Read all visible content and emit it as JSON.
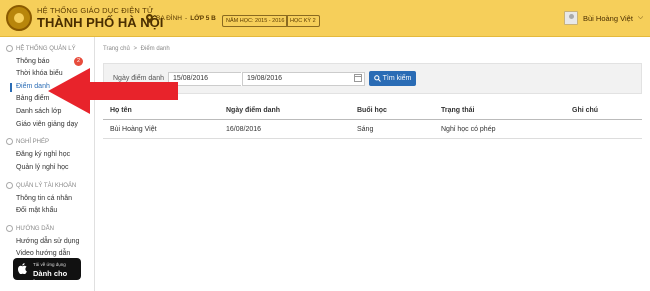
{
  "header": {
    "brand_top": "HỆ THỐNG GIÁO DỤC ĐIỆN TỬ",
    "brand_bottom": "THÀNH PHỐ HÀ NỘI",
    "location_area": "BA ĐÌNH",
    "location_sep": " - ",
    "location_class": "LỚP 5 B",
    "school_year": "NĂM HỌC: 2015 - 2016",
    "semester": "HỌC KỲ 2",
    "user_name": "Bùi Hoàng Việt"
  },
  "sidebar": {
    "sections": [
      {
        "title": "HỆ THỐNG QUẢN LÝ",
        "items": [
          "Thông báo",
          "Thời khóa biểu",
          "Điểm danh",
          "Bảng điểm",
          "Danh sách lớp",
          "Giáo viên giảng dạy"
        ]
      },
      {
        "title": "NGHỈ PHÉP",
        "items": [
          "Đăng ký nghỉ học",
          "Quản lý nghỉ học"
        ]
      },
      {
        "title": "QUẢN LÝ TÀI KHOẢN",
        "items": [
          "Thông tin cá nhân",
          "Đổi mật khẩu"
        ]
      },
      {
        "title": "HƯỚNG DẪN",
        "items": [
          "Hướng dẫn sử dụng",
          "Video hướng dẫn"
        ]
      }
    ],
    "notification_count": "2",
    "appstore_small": "Tải về ứng dụng",
    "appstore_big": "Dành cho iOS"
  },
  "breadcrumb": {
    "home": "Trang chủ",
    "sep": ">",
    "current": "Điểm danh"
  },
  "filter": {
    "label": "Ngày điểm danh",
    "from_date": "15/08/2016",
    "dash": "-",
    "to_date": "19/08/2016",
    "search_label": "Tìm kiếm"
  },
  "table": {
    "headers": [
      "Họ tên",
      "Ngày điểm danh",
      "Buổi học",
      "Trạng thái",
      "Ghi chú"
    ],
    "rows": [
      [
        "Bùi Hoàng Việt",
        "16/08/2016",
        "Sáng",
        "Nghỉ học có phép",
        ""
      ]
    ]
  },
  "colors": {
    "header_bg": "#f6cf5a",
    "accent": "#2a6cb5",
    "arrow": "#e8232b"
  }
}
